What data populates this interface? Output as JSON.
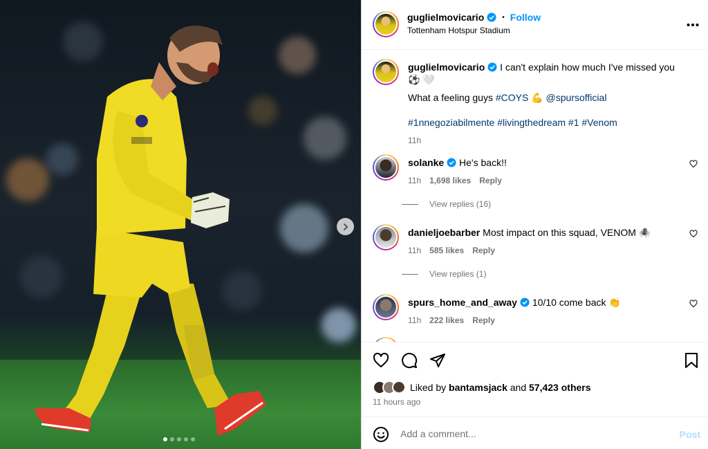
{
  "author": {
    "username": "guglielmovicario",
    "follow_label": "Follow",
    "location": "Tottenham Hotspur Stadium",
    "more_icon": "more-horizontal-icon"
  },
  "caption": {
    "username": "guglielmovicario",
    "line1": "I can't explain how much I've missed you ⚽ 🤍",
    "line2_text": "What a feeling guys",
    "line2_tag": "#COYS",
    "line2_emoji": "💪",
    "line2_mention": "@spursofficial",
    "tags": "#1nnegoziabilmente #livingthedream #1 #Venom",
    "time": "11h"
  },
  "comments": [
    {
      "username": "solanke",
      "verified": true,
      "text": "He's back!!",
      "time": "11h",
      "likes": "1,698 likes",
      "reply": "Reply",
      "view_replies": "View replies (16)"
    },
    {
      "username": "danieljoebarber",
      "verified": false,
      "text": "Most impact on this squad, VENOM 🕷️",
      "time": "11h",
      "likes": "585 likes",
      "reply": "Reply",
      "view_replies": "View replies (1)"
    },
    {
      "username": "spurs_home_and_away",
      "verified": true,
      "text": "10/10 come back 👏",
      "time": "11h",
      "likes": "222 likes",
      "reply": "Reply"
    }
  ],
  "likes": {
    "prefix": "Liked by",
    "user": "bantamsjack",
    "joiner": "and",
    "others": "57,423 others"
  },
  "posted_ago": "11 hours ago",
  "add_comment": {
    "placeholder": "Add a comment...",
    "post_label": "Post"
  },
  "carousel": {
    "slides": 5,
    "active": 0
  },
  "colors": {
    "accent": "#0095f6",
    "link": "#00376b",
    "muted": "#737373",
    "post_disabled": "#b2dffc"
  }
}
